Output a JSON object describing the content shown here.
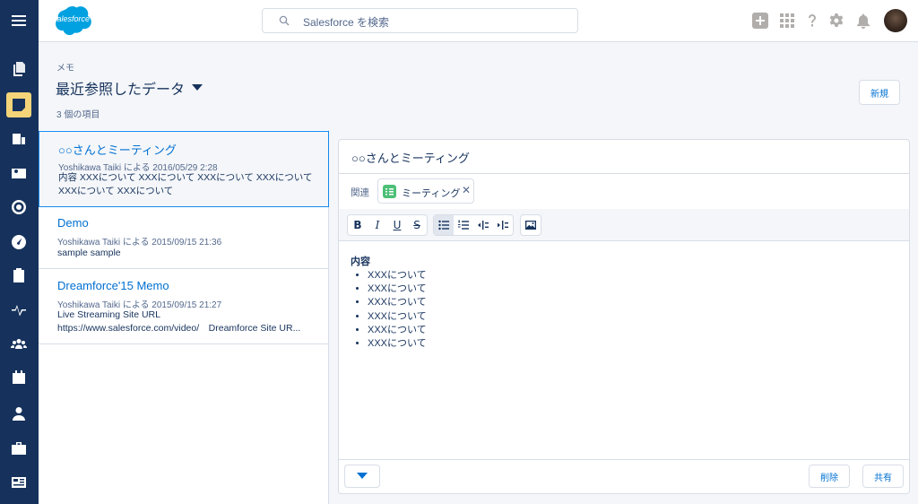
{
  "app": {
    "brand": "salesforce",
    "accent": "#0070d2",
    "nav_bg": "#16325c"
  },
  "search": {
    "placeholder": "Salesforce を検索"
  },
  "nav_icons": [
    "menu-icon",
    "files-icon",
    "notes-icon",
    "accounts-icon",
    "contacts-icon",
    "goals-icon",
    "dashboard-icon",
    "reports-icon",
    "feed-icon",
    "groups-icon",
    "calendar-icon",
    "people-icon",
    "cases-icon",
    "news-icon"
  ],
  "page": {
    "object_label": "メモ",
    "list_view": "最近参照したデータ",
    "item_count": "3 個の項目",
    "new_button": "新規"
  },
  "notes": [
    {
      "title": "○○さんとミーティング",
      "meta": "Yoshikawa Taiki による 2016/05/29 2:28",
      "body": [
        "内容 XXXについて XXXについて XXXについて XXXについて",
        "XXXについて XXXについて"
      ]
    },
    {
      "title": "Demo",
      "meta": "Yoshikawa Taiki による 2015/09/15 21:36",
      "body": [
        "sample sample"
      ]
    },
    {
      "title": "Dreamforce'15 Memo",
      "meta": "Yoshikawa Taiki による 2015/09/15 21:27",
      "body": [
        "Live Streaming Site URL",
        "https://www.salesforce.com/video/　Dreamforce Site UR..."
      ]
    }
  ],
  "detail": {
    "title": "○○さんとミーティング",
    "related_label": "関連",
    "related_pill": "ミーティング",
    "heading": "内容",
    "bullets": [
      "XXXについて",
      "XXXについて",
      "XXXについて",
      "XXXについて",
      "XXXについて",
      "XXXについて"
    ],
    "delete_button": "削除",
    "share_button": "共有"
  },
  "toolbar": {
    "bold": "B",
    "italic": "I",
    "underline": "U",
    "strike": "S"
  }
}
